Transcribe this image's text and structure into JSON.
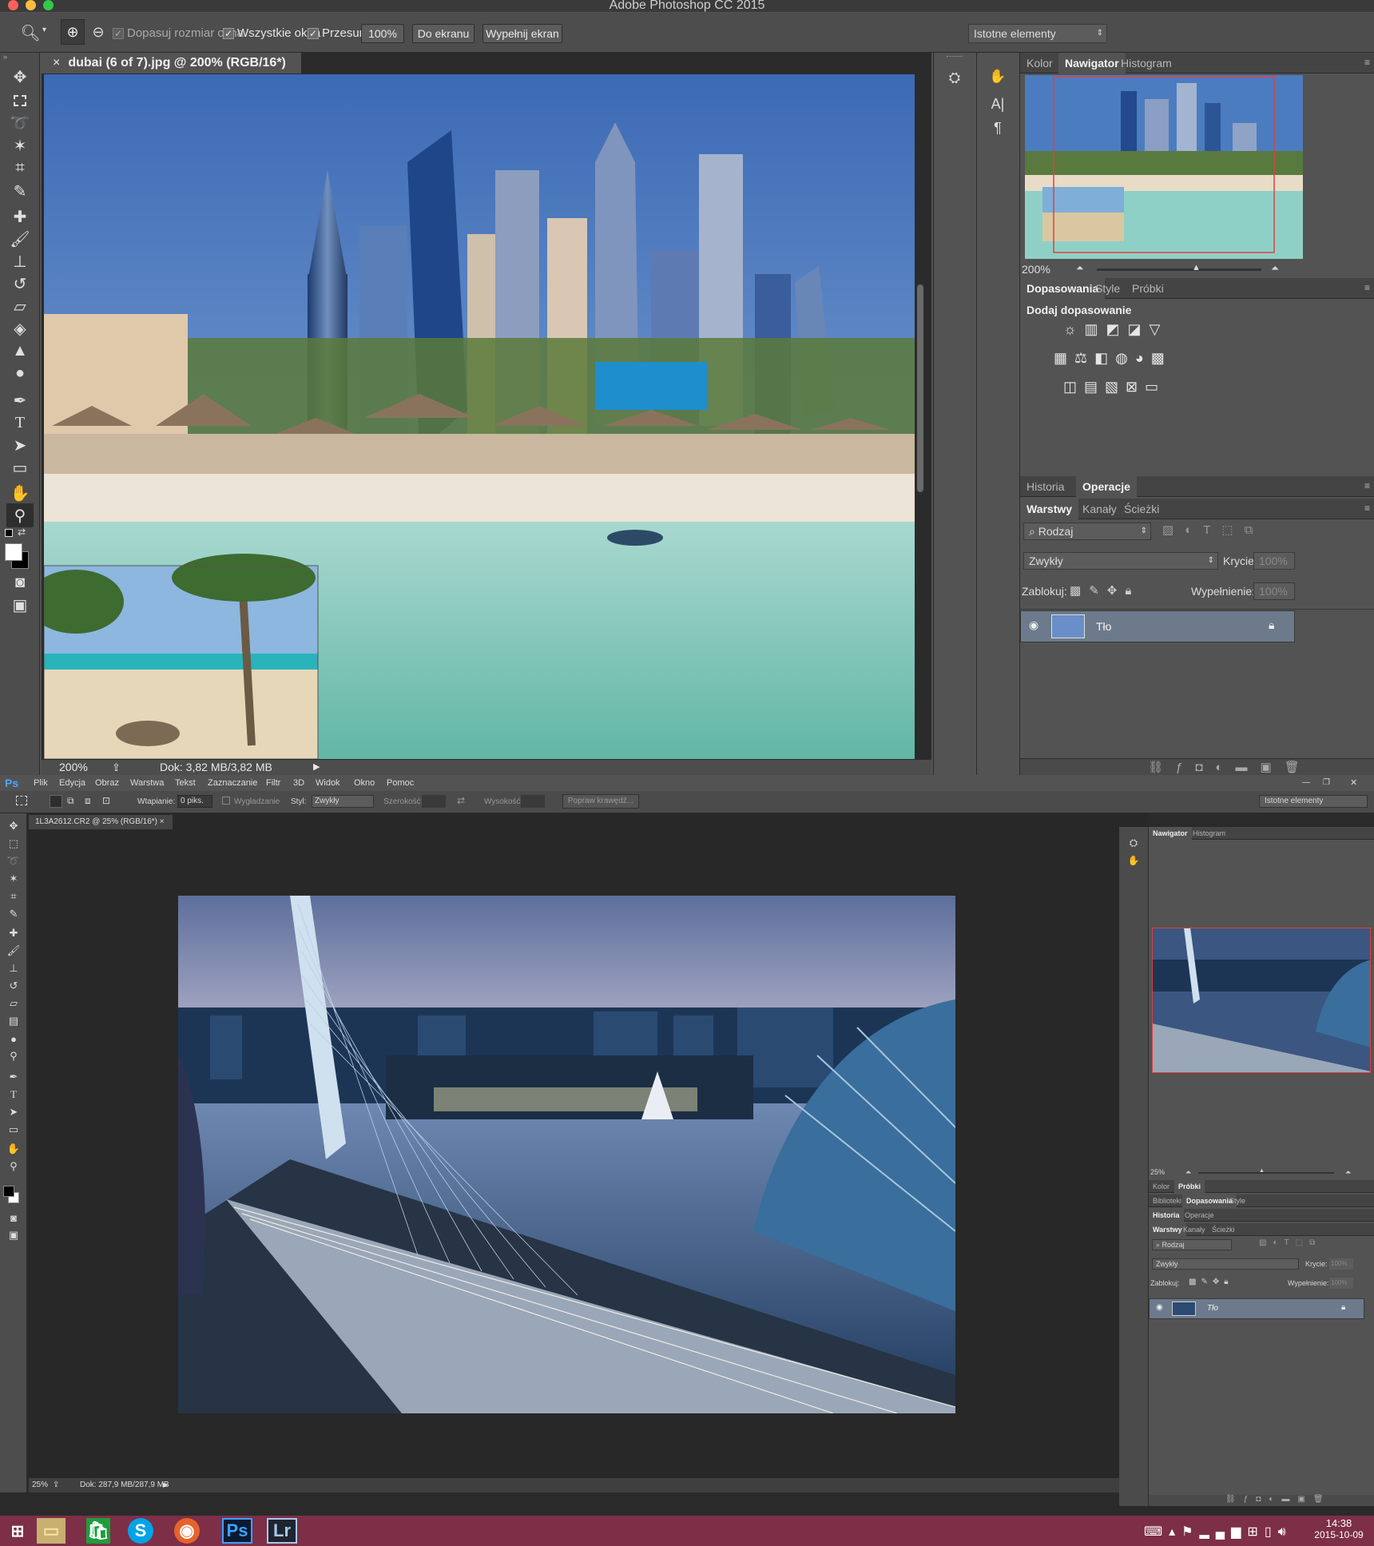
{
  "top_window": {
    "title": "Adobe Photoshop CC 2015",
    "options": {
      "fit_window": "Dopasuj rozmiar okna",
      "all_windows": "Wszystkie okna",
      "scrubby": "Przesuń",
      "zoom_100": "100%",
      "fit_screen": "Do ekranu",
      "fill_screen": "Wypełnij ekran",
      "workspace": "Istotne elementy"
    },
    "document_tab": "dubai (6 of 7).jpg @ 200% (RGB/16*)",
    "status": {
      "zoom": "200%",
      "doc": "Dok: 3,82 MB/3,82 MB"
    },
    "navigator": {
      "tabs": [
        "Kolor",
        "Nawigator",
        "Histogram"
      ],
      "active": "Nawigator",
      "zoom": "200%",
      "zoom_level": 0.6
    },
    "adjustments": {
      "tabs": [
        "Dopasowania",
        "Style",
        "Próbki"
      ],
      "heading": "Dodaj dopasowanie"
    },
    "history_tabs": [
      "Historia",
      "Operacje"
    ],
    "layers": {
      "tabs": [
        "Warstwy",
        "Kanały",
        "Ścieżki"
      ],
      "filter": "Rodzaj",
      "blend": "Zwykły",
      "opacity_label": "Krycie:",
      "opacity": "100%",
      "lock_label": "Zablokuj:",
      "fill_label": "Wypełnienie:",
      "fill": "100%",
      "layer_name": "Tło"
    }
  },
  "bottom_window": {
    "menu": [
      "Ps",
      "Plik",
      "Edycja",
      "Obraz",
      "Warstwa",
      "Tekst",
      "Zaznaczanie",
      "Filtr",
      "3D",
      "Widok",
      "Okno",
      "Pomoc"
    ],
    "options": {
      "feather_label": "Wtapianie:",
      "feather": "0 piks.",
      "antialias": "Wygładzanie",
      "style_label": "Styl:",
      "style": "Zwykły",
      "width_label": "Szerokość:",
      "height_label": "Wysokość:",
      "refine": "Popraw krawędź...",
      "workspace": "Istotne elementy"
    },
    "document_tab": "1L3A2612.CR2 @ 25% (RGB/16*)",
    "status": {
      "zoom": "25%",
      "doc": "Dok: 287,9 MB/287,9 MB"
    },
    "navigator": {
      "tabs": [
        "Nawigator",
        "Histogram"
      ],
      "zoom": "25%",
      "zoom_level": 0.45
    },
    "color_tabs": [
      "Kolor",
      "Próbki"
    ],
    "adj_tabs": [
      "Biblioteki",
      "Dopasowania",
      "Style"
    ],
    "history_tabs": [
      "Historia",
      "Operacje"
    ],
    "layers": {
      "tabs": [
        "Warstwy",
        "Kanały",
        "Ścieżki"
      ],
      "filter": "Rodzaj",
      "blend": "Zwykły",
      "opacity_label": "Krycie:",
      "opacity": "100%",
      "lock_label": "Zablokuj:",
      "fill_label": "Wypełnienie:",
      "fill": "100%",
      "layer_name": "Tło"
    }
  },
  "taskbar": {
    "time": "14:38",
    "date": "2015-10-09"
  },
  "colors": {
    "panel": "#535353",
    "dark": "#282828",
    "taskbar": "#7d2f48",
    "nav_frame": "#e04040"
  }
}
